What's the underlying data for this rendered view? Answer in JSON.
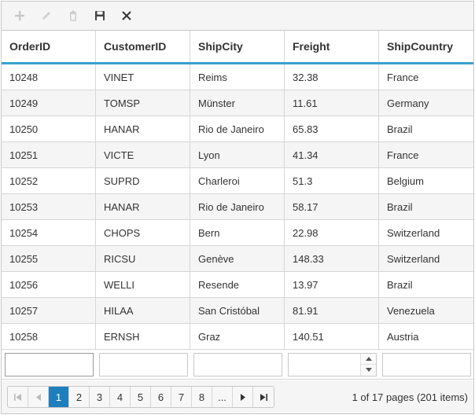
{
  "toolbar": {
    "add_label": "",
    "edit_label": "",
    "delete_label": "",
    "update_label": "",
    "cancel_label": ""
  },
  "columns": [
    "OrderID",
    "CustomerID",
    "ShipCity",
    "Freight",
    "ShipCountry"
  ],
  "rows": [
    [
      "10248",
      "VINET",
      "Reims",
      "32.38",
      "France"
    ],
    [
      "10249",
      "TOMSP",
      "Münster",
      "11.61",
      "Germany"
    ],
    [
      "10250",
      "HANAR",
      "Rio de Janeiro",
      "65.83",
      "Brazil"
    ],
    [
      "10251",
      "VICTE",
      "Lyon",
      "41.34",
      "France"
    ],
    [
      "10252",
      "SUPRD",
      "Charleroi",
      "51.3",
      "Belgium"
    ],
    [
      "10253",
      "HANAR",
      "Rio de Janeiro",
      "58.17",
      "Brazil"
    ],
    [
      "10254",
      "CHOPS",
      "Bern",
      "22.98",
      "Switzerland"
    ],
    [
      "10255",
      "RICSU",
      "Genève",
      "148.33",
      "Switzerland"
    ],
    [
      "10256",
      "WELLI",
      "Resende",
      "13.97",
      "Brazil"
    ],
    [
      "10257",
      "HILAA",
      "San Cristóbal",
      "81.91",
      "Venezuela"
    ],
    [
      "10258",
      "ERNSH",
      "Graz",
      "140.51",
      "Austria"
    ]
  ],
  "edit_row": {
    "order_id": "",
    "customer_id": "",
    "ship_city": "",
    "freight": "",
    "ship_country": ""
  },
  "pager": {
    "pages": [
      "1",
      "2",
      "3",
      "4",
      "5",
      "6",
      "7",
      "8",
      "..."
    ],
    "current": "1",
    "info": "1 of 17 pages (201 items)"
  },
  "colors": {
    "accent": "#3aa0d0",
    "active_page": "#1f7fbd",
    "alt_row": "#f5f5f5",
    "border": "#c8c8c8"
  }
}
